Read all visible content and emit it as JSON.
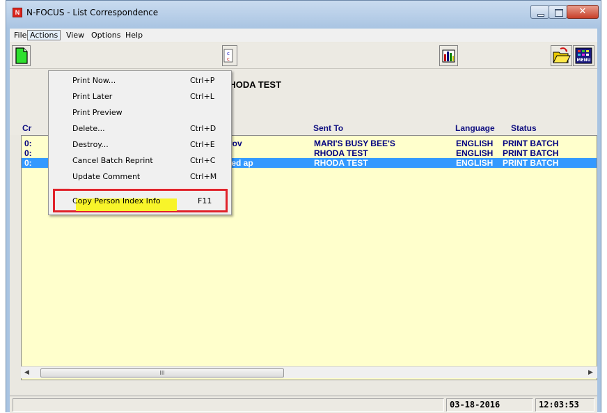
{
  "window": {
    "title": "N-FOCUS - List Correspondence",
    "app_icon_letter": "N"
  },
  "menubar": {
    "items": [
      "File",
      "Actions",
      "View",
      "Options",
      "Help"
    ],
    "open_menu": "Actions"
  },
  "actions_menu": {
    "items": [
      {
        "label": "Print Now...",
        "shortcut": "Ctrl+P"
      },
      {
        "label": "Print Later",
        "shortcut": "Ctrl+L"
      },
      {
        "label": "Print Preview",
        "shortcut": ""
      },
      {
        "label": "Delete...",
        "shortcut": "Ctrl+D"
      },
      {
        "label": "Destroy...",
        "shortcut": "Ctrl+E"
      },
      {
        "label": "Cancel Batch Reprint",
        "shortcut": "Ctrl+C"
      },
      {
        "label": "Update Comment",
        "shortcut": "Ctrl+M"
      },
      {
        "label": "Copy Person Index Info",
        "shortcut": "F11"
      }
    ],
    "highlighted_item": "Copy Person Index Info",
    "highlight_color": "#e0222a",
    "marker_color": "#f8f42a"
  },
  "header": {
    "case_name": "RHODA TEST"
  },
  "columns": {
    "col1": "Cr",
    "sent_to": "Sent To",
    "language": "Language",
    "status": "Status"
  },
  "rows": [
    {
      "col1": "0:",
      "desc": "Prov",
      "sent_to": "MARI'S BUSY BEE'S",
      "language": "ENGLISH",
      "status": "PRINT BATCH",
      "selected": false
    },
    {
      "col1": "0:",
      "desc": "",
      "sent_to": "RHODA TEST",
      "language": "ENGLISH",
      "status": "PRINT BATCH",
      "selected": false
    },
    {
      "col1": "0:",
      "desc": "nted ap",
      "sent_to": "RHODA TEST",
      "language": "ENGLISH",
      "status": "PRINT BATCH",
      "selected": true
    }
  ],
  "scrollbar": {
    "thumb_grip": "III"
  },
  "statusbar": {
    "date": "03-18-2016",
    "time": "12:03:53"
  },
  "colors": {
    "list_background": "#ffffcc",
    "selection": "#3399ff",
    "list_text": "#000080"
  },
  "icons": {
    "new": "new-document-icon",
    "text": "text-abc-icon",
    "chart": "bar-chart-icon",
    "open": "open-folder-icon",
    "menu": "menu-grid-icon"
  },
  "labels": {
    "menu_button_text": "MENU"
  }
}
